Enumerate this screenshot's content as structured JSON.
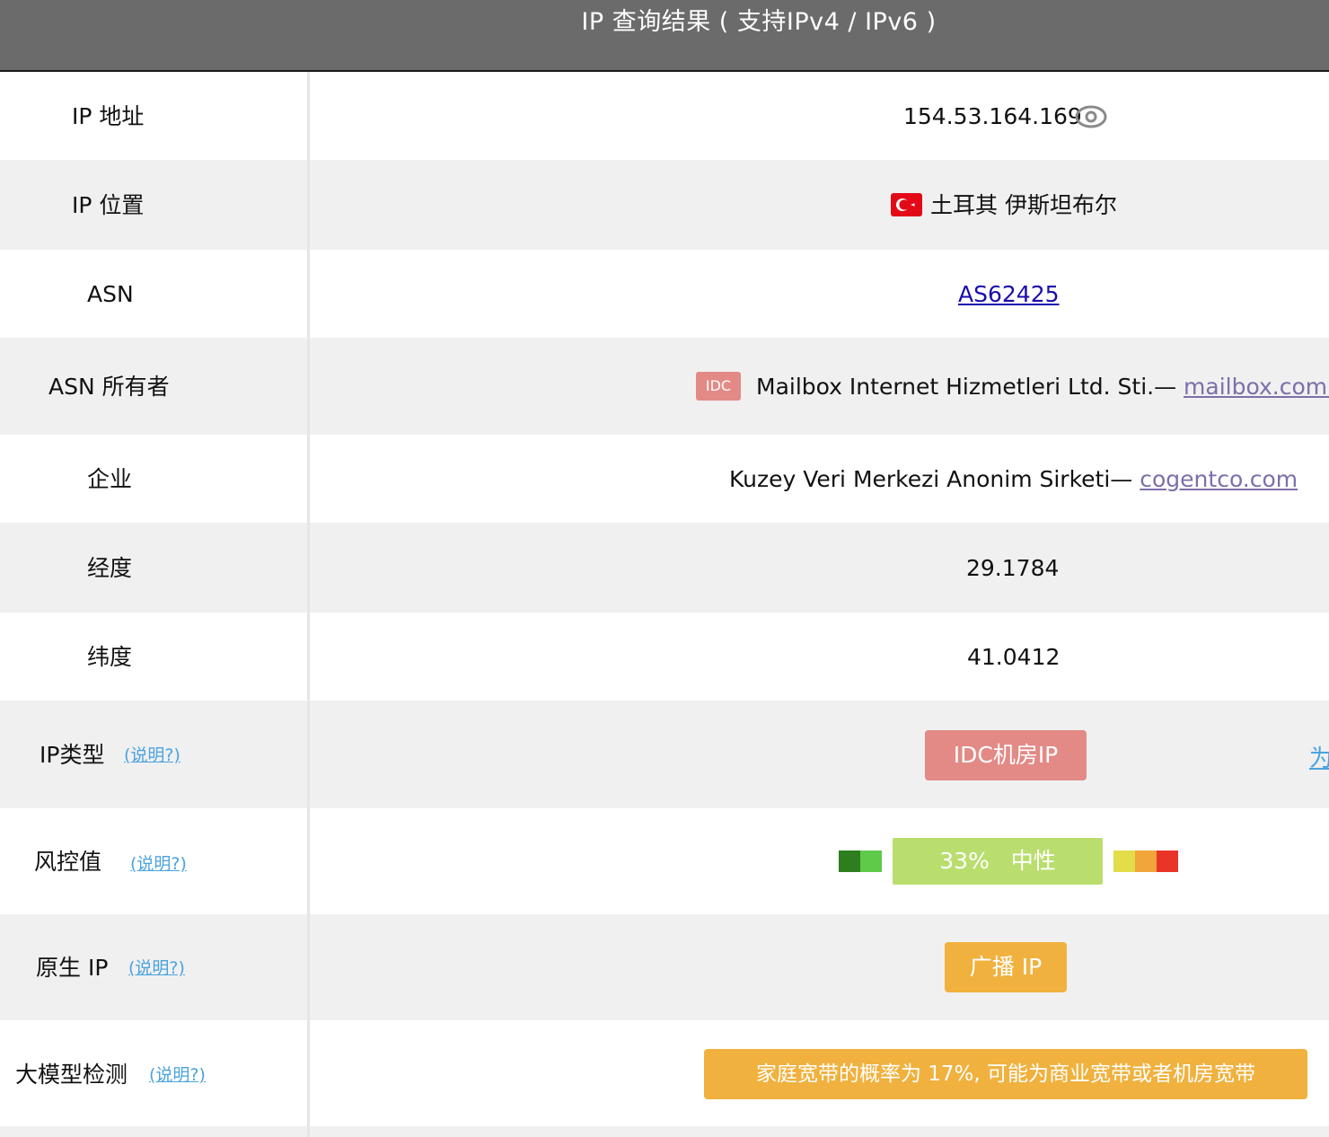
{
  "header": {
    "title": "IP 查询结果 ( 支持IPv4 / IPv6 )"
  },
  "rows": {
    "ip": {
      "label": "IP 地址",
      "value": "154.53.164.169"
    },
    "location": {
      "label": "IP 位置",
      "value": "土耳其 伊斯坦布尔",
      "flag_icon": "turkey-flag-icon"
    },
    "asn": {
      "label": "ASN",
      "value": "AS62425"
    },
    "asn_owner": {
      "label": "ASN 所有者",
      "badge": "IDC",
      "value": "Mailbox Internet Hizmetleri Ltd. Sti.—",
      "link": "mailbox.com.tr"
    },
    "company": {
      "label": "企业",
      "value": "Kuzey Veri Merkezi Anonim Sirketi—",
      "link": "cogentco.com"
    },
    "longitude": {
      "label": "经度",
      "value": "29.1784"
    },
    "latitude": {
      "label": "纬度",
      "value": "41.0412"
    },
    "ip_type": {
      "label": "IP类型",
      "help": "(说明?)",
      "pill": "IDC机房IP",
      "edge_text": "为"
    },
    "risk": {
      "label": "风控值",
      "help": "(说明?)",
      "percent": "33%",
      "level": "中性",
      "score": 0.33
    },
    "native": {
      "label": "原生 IP",
      "help": "(说明?)",
      "pill": "广播 IP"
    },
    "llm": {
      "label": "大模型检测",
      "help": "(说明?)",
      "pill": "家庭宽带的概率为 17%, 可能为商业宽带或者机房宽带"
    }
  },
  "colors": {
    "header_bg": "#6b6b6b",
    "row_gray": "#f0f0f0",
    "help_link": "#4aa3df",
    "asn_link": "#1a0dab",
    "visited_link": "#7d6fa8",
    "idc_badge": "#e38a86",
    "risk_neutral": "#b9de6e",
    "orange_pill": "#f0b13e",
    "risk_scale": [
      "#2e7d1e",
      "#5fc94a",
      "#e2dd48",
      "#f2a53a",
      "#e83528"
    ]
  }
}
